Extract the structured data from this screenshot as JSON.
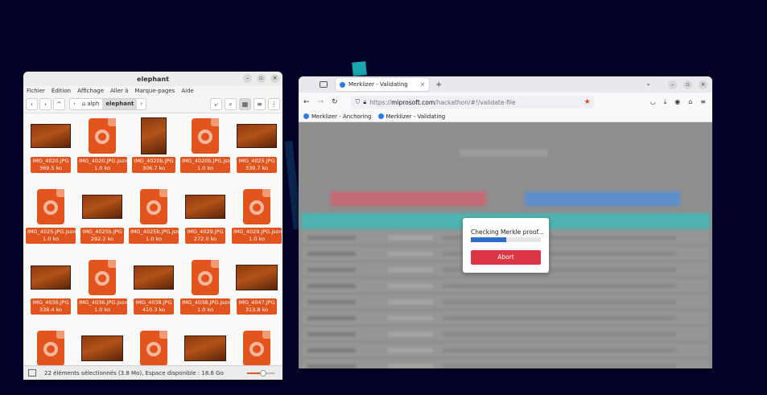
{
  "file_manager": {
    "title": "elephant",
    "menu": [
      "Fichier",
      "Édition",
      "Affichage",
      "Aller à",
      "Marque-pages",
      "Aide"
    ],
    "breadcrumb": {
      "parent": "alph",
      "current": "elephant"
    },
    "files": [
      {
        "name": "IMG_4020.JPG",
        "size": "369.5 ko",
        "kind": "photo"
      },
      {
        "name": "IMG_4020.JPG.json",
        "size": "1.0 ko",
        "kind": "json"
      },
      {
        "name": "IMG_4020b.JPG",
        "size": "306.7 ko",
        "kind": "photo-portrait"
      },
      {
        "name": "IMG_4020b.JPG.json",
        "size": "1.0 ko",
        "kind": "json"
      },
      {
        "name": "IMG_4025.JPG",
        "size": "339.7 ko",
        "kind": "photo"
      },
      {
        "name": "IMG_4025.JPG.json",
        "size": "1.0 ko",
        "kind": "json"
      },
      {
        "name": "IMG_4025b.JPG",
        "size": "292.2 ko",
        "kind": "photo"
      },
      {
        "name": "IMG_4025b.JPG.json",
        "size": "1.0 ko",
        "kind": "json"
      },
      {
        "name": "IMG_4029.JPG",
        "size": "272.0 ko",
        "kind": "photo"
      },
      {
        "name": "IMG_4029.JPG.json",
        "size": "1.0 ko",
        "kind": "json"
      },
      {
        "name": "IMG_4036.JPG",
        "size": "338.4 ko",
        "kind": "photo"
      },
      {
        "name": "IMG_4036.JPG.json",
        "size": "1.0 ko",
        "kind": "json"
      },
      {
        "name": "IMG_4038.JPG",
        "size": "410.3 ko",
        "kind": "photo"
      },
      {
        "name": "IMG_4038.JPG.json",
        "size": "1.0 ko",
        "kind": "json"
      },
      {
        "name": "IMG_4047.JPG",
        "size": "313.8 ko",
        "kind": "photo-wide"
      },
      {
        "name": "",
        "size": "",
        "kind": "json"
      },
      {
        "name": "",
        "size": "",
        "kind": "photo-wide"
      },
      {
        "name": "",
        "size": "",
        "kind": "json"
      },
      {
        "name": "",
        "size": "",
        "kind": "photo-wide"
      },
      {
        "name": "",
        "size": "",
        "kind": "json"
      }
    ],
    "status": "22 éléments sélectionnés (3.8 Mo), Espace disponible : 18.6 Go",
    "zoom_level": 0.6,
    "accent_color": "#e2541d"
  },
  "browser": {
    "tab_title": "Merklizer - Validating",
    "url_scheme": "https://",
    "url_host": "miprosoft.com",
    "url_path": "/hackathon/#!/validate-file",
    "bookmarks": [
      "Merklizer - Anchoring",
      "Merklizer - Validating"
    ],
    "modal": {
      "message": "Checking Merkle proof...",
      "progress": 0.5,
      "abort_label": "Abort"
    }
  }
}
